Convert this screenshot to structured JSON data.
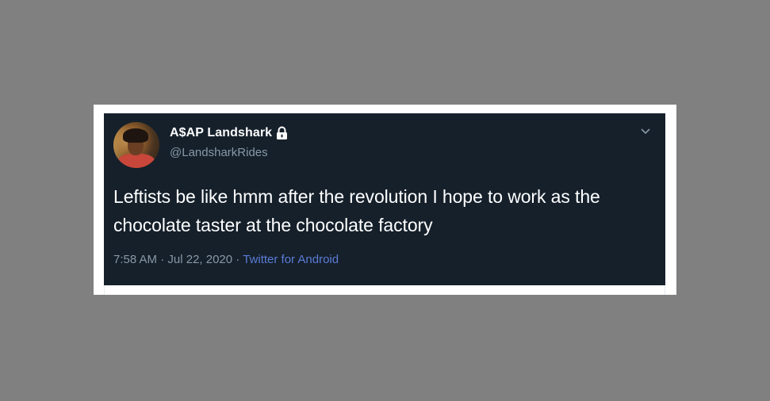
{
  "tweet": {
    "display_name": "A$AP Landshark",
    "handle": "@LandsharkRides",
    "protected": true,
    "text": "Leftists be like hmm after the revolution I hope to work as the chocolate taster at the chocolate factory",
    "time": "7:58 AM",
    "separator": "·",
    "date": "Jul 22, 2020",
    "source": "Twitter for Android"
  },
  "icons": {
    "lock": "lock-icon",
    "menu": "chevron-down-icon"
  },
  "colors": {
    "background": "#808080",
    "tweet_bg": "#15202b",
    "text": "#ffffff",
    "secondary": "#8899a6",
    "source_link": "#5b7bd5"
  }
}
